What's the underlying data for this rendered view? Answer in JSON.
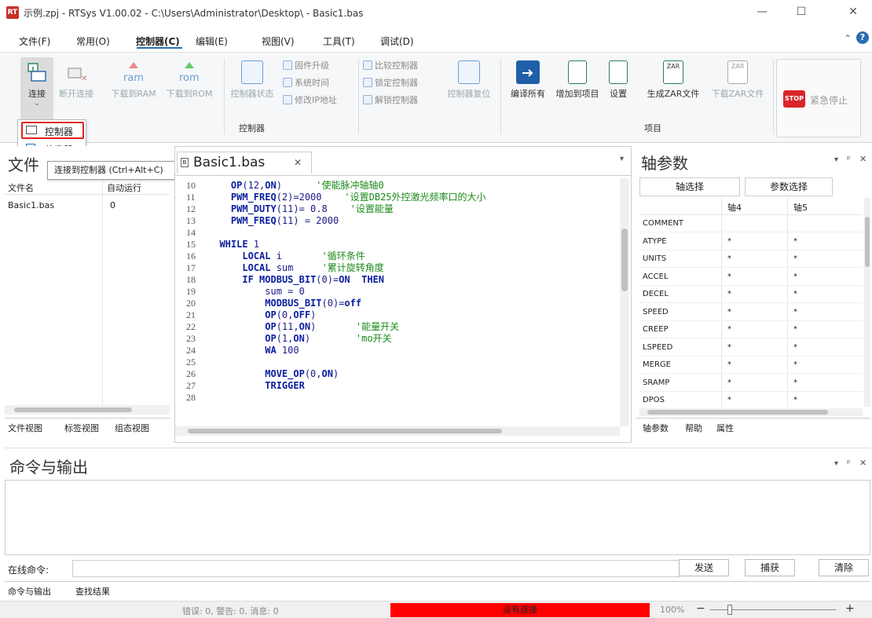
{
  "window": {
    "logo": "RT",
    "title": "示例.zpj - RTSys V1.00.02 - C:\\Users\\Administrator\\Desktop\\ - Basic1.bas",
    "minimize": "—",
    "maximize": "☐",
    "close": "✕"
  },
  "menu": [
    "文件(F)",
    "常用(O)",
    "控制器(C)",
    "编辑(E)",
    "视图(V)",
    "工具(T)",
    "调试(D)"
  ],
  "ribbon": {
    "connect": "连接",
    "disconnect": "断开连接",
    "download_ram": "下载到RAM",
    "download_rom": "下载到ROM",
    "controller_status": "控制器状态",
    "firmware_upgrade": "固件升级",
    "system_time": "系统时间",
    "modify_ip": "修改IP地址",
    "compare_controller": "比较控制器",
    "lock_controller": "锁定控制器",
    "unlock_controller": "解锁控制器",
    "controller_reset": "控制器复位",
    "compile_all": "编译所有",
    "add_to_project": "增加到项目",
    "settings": "设置",
    "generate_zar": "生成ZAR文件",
    "download_zar": "下载ZAR文件",
    "emergency_stop": "紧急停止",
    "stop_badge": "STOP",
    "group_controller": "控制器",
    "group_project": "项目",
    "ram_text": "ram",
    "rom_text": "rom",
    "zar_text": "ZAR"
  },
  "dropdown": {
    "items": [
      "控制器",
      "仿真器"
    ],
    "tooltip": "连接到控制器 (Ctrl+Alt+C)"
  },
  "file_panel": {
    "title": "文件",
    "columns": [
      "文件名",
      "自动运行"
    ],
    "rows": [
      {
        "name": "Basic1.bas",
        "auto": "0"
      }
    ],
    "tabs": [
      "文件视图",
      "标签视图",
      "组态视图"
    ]
  },
  "editor": {
    "tab_title": "Basic1.bas",
    "lines": [
      {
        "n": "10",
        "code": "    OP(12,ON)      '使能脉冲轴轴0"
      },
      {
        "n": "11",
        "code": "    PWM_FREQ(2)=2000    '设置DB25外控激光频率口的大小"
      },
      {
        "n": "12",
        "code": "    PWM_DUTY(11)= 0.8    '设置能量"
      },
      {
        "n": "13",
        "code": "    PWM_FREQ(11) = 2000"
      },
      {
        "n": "14",
        "code": ""
      },
      {
        "n": "15",
        "code": "  WHILE 1"
      },
      {
        "n": "16",
        "code": "      LOCAL i       '循环条件"
      },
      {
        "n": "17",
        "code": "      LOCAL sum     '累计旋转角度"
      },
      {
        "n": "18",
        "code": "      IF MODBUS_BIT(0)=ON  THEN"
      },
      {
        "n": "19",
        "code": "          sum = 0"
      },
      {
        "n": "20",
        "code": "          MODBUS_BIT(0)=off"
      },
      {
        "n": "21",
        "code": "          OP(0,OFF)"
      },
      {
        "n": "22",
        "code": "          OP(11,ON)       '能量开关"
      },
      {
        "n": "23",
        "code": "          OP(1,ON)        'mo开关"
      },
      {
        "n": "24",
        "code": "          WA 100"
      },
      {
        "n": "25",
        "code": ""
      },
      {
        "n": "26",
        "code": "          MOVE_OP(0,ON)"
      },
      {
        "n": "27",
        "code": "          TRIGGER"
      },
      {
        "n": "28",
        "code": ""
      }
    ]
  },
  "axis_panel": {
    "title": "轴参数",
    "axis_select": "轴选择",
    "param_select": "参数选择",
    "columns": [
      "轴4",
      "轴5"
    ],
    "rows": [
      {
        "name": "COMMENT",
        "v1": "",
        "v2": ""
      },
      {
        "name": "ATYPE",
        "v1": "*",
        "v2": "*"
      },
      {
        "name": "UNITS",
        "v1": "*",
        "v2": "*"
      },
      {
        "name": "ACCEL",
        "v1": "*",
        "v2": "*"
      },
      {
        "name": "DECEL",
        "v1": "*",
        "v2": "*"
      },
      {
        "name": "SPEED",
        "v1": "*",
        "v2": "*"
      },
      {
        "name": "CREEP",
        "v1": "*",
        "v2": "*"
      },
      {
        "name": "LSPEED",
        "v1": "*",
        "v2": "*"
      },
      {
        "name": "MERGE",
        "v1": "*",
        "v2": "*"
      },
      {
        "name": "SRAMP",
        "v1": "*",
        "v2": "*"
      },
      {
        "name": "DPOS",
        "v1": "*",
        "v2": "*"
      }
    ],
    "tabs": [
      "轴参数",
      "帮助",
      "属性"
    ]
  },
  "output_panel": {
    "title": "命令与输出",
    "online_cmd_label": "在线命令:",
    "send": "发送",
    "capture": "捕获",
    "clear": "清除",
    "tabs": [
      "命令与输出",
      "查找结果"
    ]
  },
  "statusbar": {
    "counts": "错误: 0, 警告: 0, 消息: 0",
    "connection": "没有连接",
    "zoom": "100%",
    "zoom_minus": "−",
    "zoom_plus": "+"
  },
  "colors": {
    "accent_blue": "#2b6cb0",
    "red_highlight": "#e02020",
    "status_red": "#ff0000"
  }
}
